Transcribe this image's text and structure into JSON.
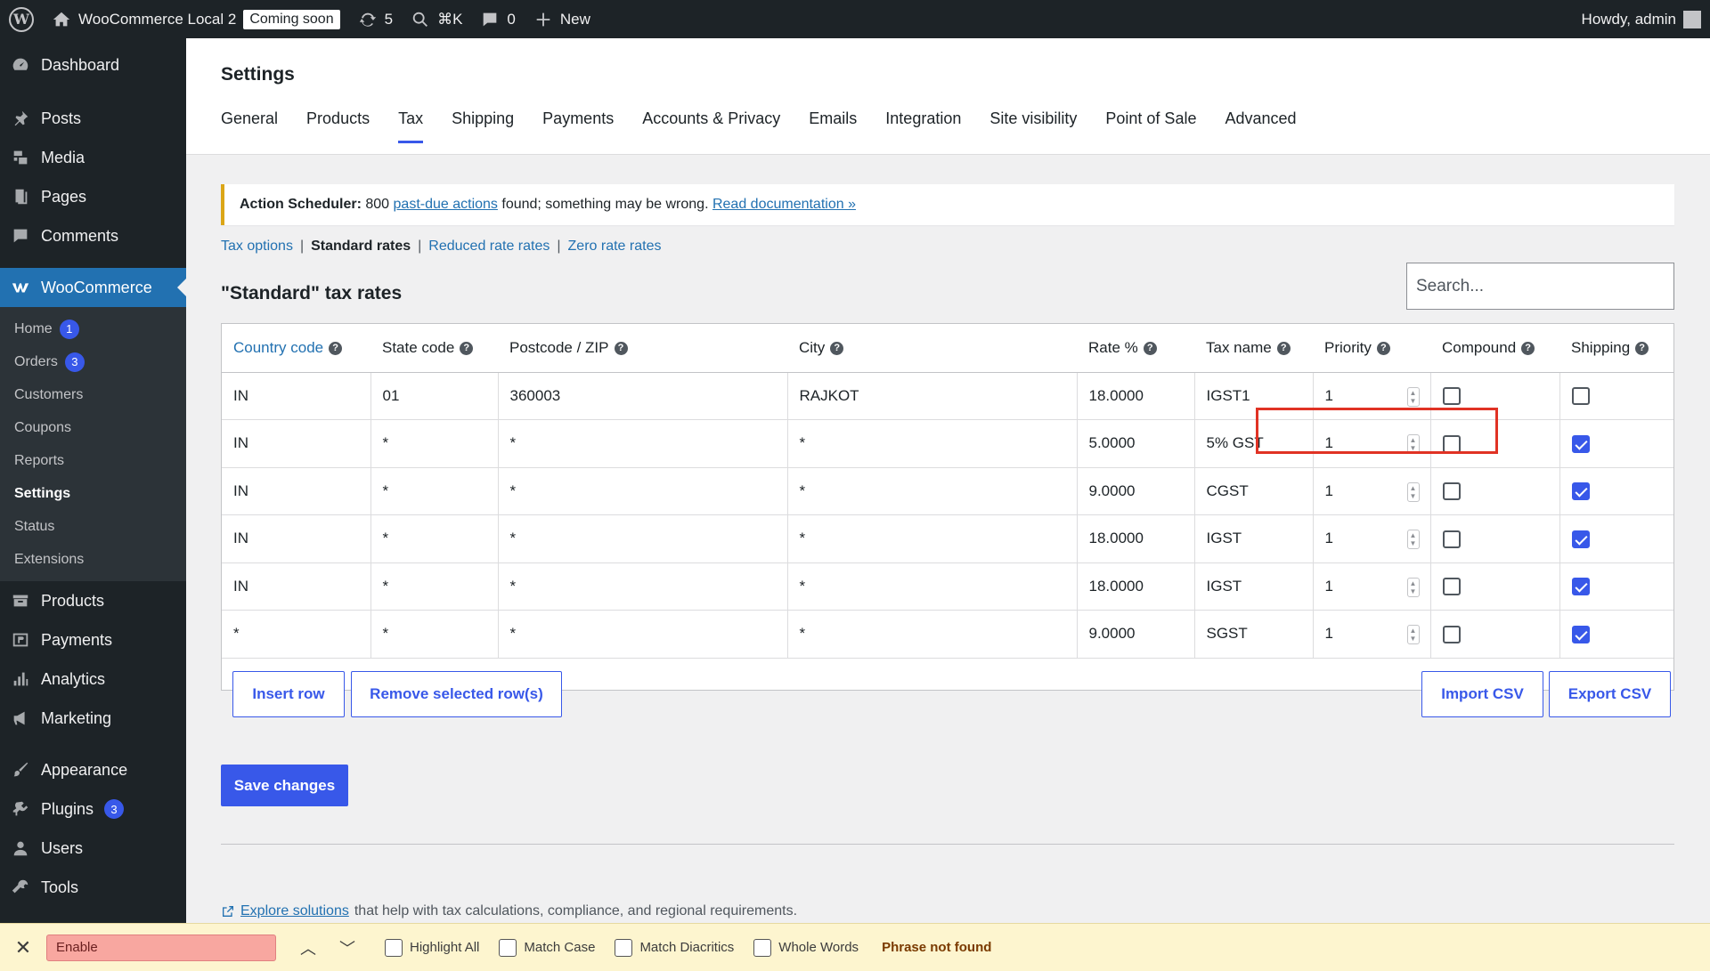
{
  "adminbar": {
    "site_name": "WooCommerce Local 2",
    "coming_soon": "Coming soon",
    "updates_count": "5",
    "search_shortcut": "⌘K",
    "comments_count": "0",
    "new_label": "New",
    "howdy": "Howdy, admin"
  },
  "sidebar": {
    "dashboard": "Dashboard",
    "posts": "Posts",
    "media": "Media",
    "pages": "Pages",
    "comments": "Comments",
    "woocommerce": "WooCommerce",
    "sub": {
      "home": "Home",
      "home_count": "1",
      "orders": "Orders",
      "orders_count": "3",
      "customers": "Customers",
      "coupons": "Coupons",
      "reports": "Reports",
      "settings": "Settings",
      "status": "Status",
      "extensions": "Extensions"
    },
    "products": "Products",
    "payments": "Payments",
    "analytics": "Analytics",
    "marketing": "Marketing",
    "appearance": "Appearance",
    "plugins": "Plugins",
    "plugins_count": "3",
    "users": "Users",
    "tools": "Tools"
  },
  "page": {
    "title": "Settings",
    "tabs": [
      "General",
      "Products",
      "Tax",
      "Shipping",
      "Payments",
      "Accounts & Privacy",
      "Emails",
      "Integration",
      "Site visibility",
      "Point of Sale",
      "Advanced"
    ]
  },
  "notice": {
    "prefix": "Action Scheduler:",
    "count": "800",
    "link1": "past-due actions",
    "middle": "found; something may be wrong.",
    "link2": "Read documentation »"
  },
  "subnav": {
    "tax_options": "Tax options",
    "standard": "Standard rates",
    "reduced": "Reduced rate rates",
    "zero": "Zero rate rates",
    "sep": "|"
  },
  "table": {
    "title": "\"Standard\" tax rates",
    "search_placeholder": "Search...",
    "headers": [
      "Country code",
      "State code",
      "Postcode / ZIP",
      "City",
      "Rate %",
      "Tax name",
      "Priority",
      "Compound",
      "Shipping"
    ],
    "help_glyph": "?",
    "rows": [
      {
        "country": "IN",
        "state": "01",
        "postcode": "360003",
        "city": "RAJKOT",
        "rate": "18.0000",
        "name": "IGST1",
        "priority": "1",
        "compound": false,
        "shipping": false
      },
      {
        "country": "IN",
        "state": "*",
        "postcode": "*",
        "city": "*",
        "rate": "5.0000",
        "name": "5% GST",
        "priority": "1",
        "compound": false,
        "shipping": true
      },
      {
        "country": "IN",
        "state": "*",
        "postcode": "*",
        "city": "*",
        "rate": "9.0000",
        "name": "CGST",
        "priority": "1",
        "compound": false,
        "shipping": true
      },
      {
        "country": "IN",
        "state": "*",
        "postcode": "*",
        "city": "*",
        "rate": "18.0000",
        "name": "IGST",
        "priority": "1",
        "compound": false,
        "shipping": true
      },
      {
        "country": "IN",
        "state": "*",
        "postcode": "*",
        "city": "*",
        "rate": "18.0000",
        "name": "IGST",
        "priority": "1",
        "compound": false,
        "shipping": true
      },
      {
        "country": "*",
        "state": "*",
        "postcode": "*",
        "city": "*",
        "rate": "9.0000",
        "name": "SGST",
        "priority": "1",
        "compound": false,
        "shipping": true
      }
    ],
    "insert_row": "Insert row",
    "remove_rows": "Remove selected row(s)",
    "import_csv": "Import CSV",
    "export_csv": "Export CSV"
  },
  "save_label": "Save changes",
  "explore": {
    "link": "Explore solutions",
    "text": "that help with tax calculations, compliance, and regional requirements."
  },
  "findbar": {
    "query": "Enable",
    "highlight_all": "Highlight All",
    "match_case": "Match Case",
    "match_diacritics": "Match Diacritics",
    "whole_words": "Whole Words",
    "status": "Phrase not found"
  },
  "colors": {
    "accent": "#3858e9",
    "highlight_box": "#e03224",
    "sidebar_current": "#2271b1"
  }
}
